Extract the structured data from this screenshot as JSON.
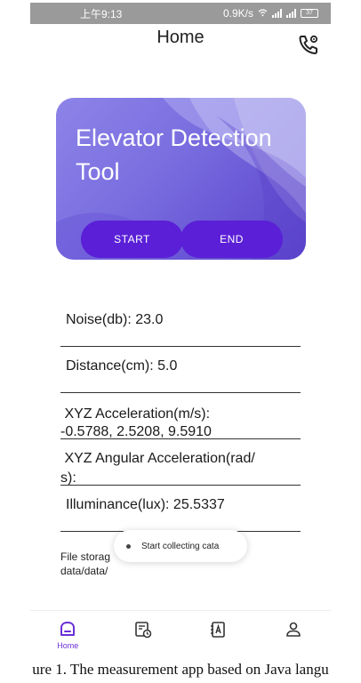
{
  "status_bar": {
    "time": "上午9:13",
    "network": "0.9K/s",
    "battery": "37"
  },
  "header": {
    "title": "Home",
    "phone_icon": "phone-settings-icon"
  },
  "hero": {
    "title": "Elevator Detection Tool",
    "start_label": "START",
    "end_label": "END",
    "colors": {
      "card": "#7b6fe0",
      "button": "#5a1fd6"
    }
  },
  "readings": {
    "noise": "Noise(db):  23.0",
    "distance": "Distance(cm):  5.0",
    "acceleration_label": " XYZ Acceleration(m/s):",
    "acceleration_value": "-0.5788, 2.5208, 9.5910",
    "angular_label": " XYZ Angular Acceleration(rad/",
    "angular_label_cont": "s):",
    "illuminance": "Illuminance(lux):  25.5337"
  },
  "file_storage": {
    "label": "File storag",
    "path": "data/data/"
  },
  "toast": {
    "message": "Start collecting cata"
  },
  "nav": {
    "items": [
      {
        "label": "Home",
        "icon": "home-icon",
        "active": true
      },
      {
        "label": "",
        "icon": "history-icon",
        "active": false
      },
      {
        "label": "",
        "icon": "contacts-icon",
        "active": false
      },
      {
        "label": "",
        "icon": "person-icon",
        "active": false
      }
    ],
    "accent": "#6a2fd4"
  },
  "caption": "ure 1. The measurement app based on Java langu"
}
